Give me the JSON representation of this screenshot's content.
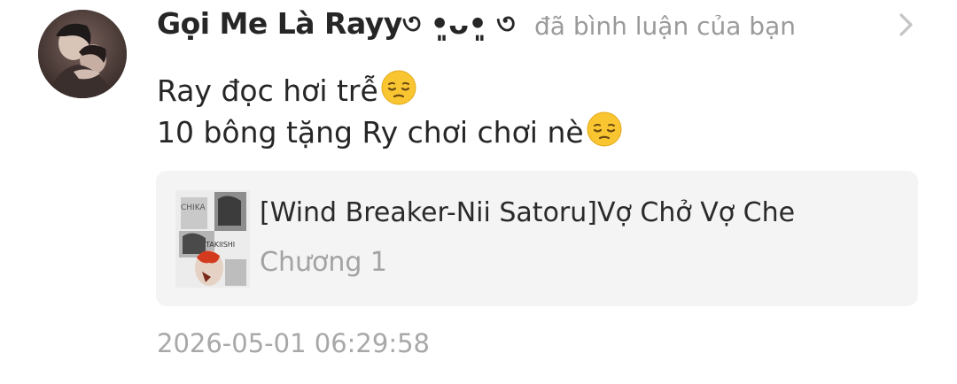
{
  "notification": {
    "user_name": "Gọi Me Là Rayy৩ •͈ᴗ•͈ ৩",
    "action_text": "đã bình luận của bạn",
    "comment_lines": [
      "Ray đọc hơi trễ",
      "10 bông tặng Ry chơi chơi nè"
    ],
    "comment_emoji": "pensive-face",
    "story": {
      "title": "[Wind Breaker-Nii Satoru]Vợ Chở Vợ Che",
      "chapter": "Chương 1",
      "cover_text_1": "CHIKA",
      "cover_text_2": "TAKIISHI"
    },
    "timestamp": "2026-05-01 06:29:58",
    "icons": {
      "arrow": "chevron-right-icon",
      "emoji": "pensive-face-emoji"
    }
  },
  "colors": {
    "text_primary": "#262626",
    "text_secondary": "#9a9a9a",
    "card_background": "#f4f4f4",
    "emoji_yellow": "#f9c531"
  }
}
